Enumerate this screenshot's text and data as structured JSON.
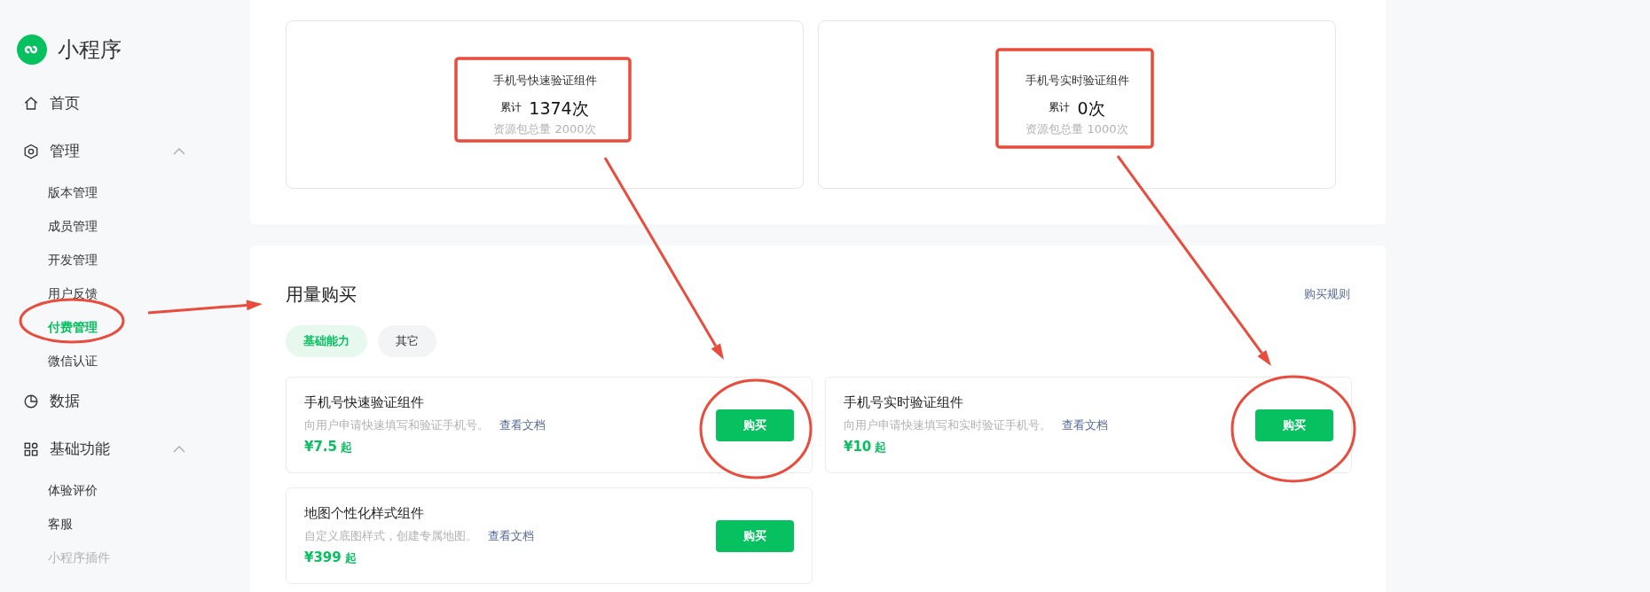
{
  "sidebar": {
    "app_name": "小程序",
    "items": [
      {
        "label": "首页",
        "selected": false
      },
      {
        "label": "管理",
        "selected": false,
        "expanded": true,
        "children": [
          {
            "label": "版本管理",
            "selected": false,
            "disabled": false
          },
          {
            "label": "成员管理",
            "selected": false,
            "disabled": false
          },
          {
            "label": "开发管理",
            "selected": false,
            "disabled": false
          },
          {
            "label": "用户反馈",
            "selected": false,
            "disabled": false
          },
          {
            "label": "付费管理",
            "selected": true,
            "disabled": false
          },
          {
            "label": "微信认证",
            "selected": false,
            "disabled": false
          }
        ]
      },
      {
        "label": "数据",
        "selected": false
      },
      {
        "label": "基础功能",
        "selected": false,
        "expanded": true,
        "children": [
          {
            "label": "体验评价",
            "selected": false,
            "disabled": false
          },
          {
            "label": "客服",
            "selected": false,
            "disabled": false
          },
          {
            "label": "小程序插件",
            "selected": false,
            "disabled": true
          }
        ]
      }
    ]
  },
  "usage": [
    {
      "title": "手机号快速验证组件",
      "label": "累计",
      "count": "1374次",
      "total": "资源包总量 2000次"
    },
    {
      "title": "手机号实时验证组件",
      "label": "累计",
      "count": "0次",
      "total": "资源包总量 1000次"
    }
  ],
  "purchase": {
    "title": "用量购买",
    "rules_link": "购买规则",
    "tabs": [
      {
        "label": "基础能力",
        "selected": true
      },
      {
        "label": "其它",
        "selected": false
      }
    ],
    "products": [
      {
        "name": "手机号快速验证组件",
        "description": "向用户申请快速填写和验证手机号。",
        "link": "查看文档",
        "price": "¥7.5",
        "price_suffix": "起",
        "button": "购买"
      },
      {
        "name": "手机号实时验证组件",
        "description": "向用户申请快速填写和实时验证手机号。",
        "link": "查看文档",
        "price": "¥10",
        "price_suffix": "起",
        "button": "购买"
      },
      {
        "name": "地图个性化样式组件",
        "description": "自定义底图样式，创建专属地图。",
        "link": "查看文档",
        "price": "¥399",
        "price_suffix": "起",
        "button": "购买"
      }
    ]
  }
}
